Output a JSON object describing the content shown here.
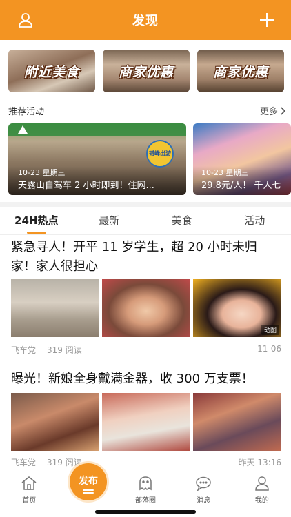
{
  "header": {
    "title": "发现",
    "left_icon": "user-icon",
    "right_icon": "plus-icon",
    "color": "#f39422"
  },
  "banners": [
    {
      "label": "附近美食"
    },
    {
      "label": "商家优惠"
    },
    {
      "label": "商家优惠"
    }
  ],
  "recommend": {
    "title": "推荐活动",
    "more_label": "更多"
  },
  "activities": [
    {
      "date": "10-23 星期三",
      "desc": "天露山自驾车 2 小时即到！住网...",
      "badge": "错峰出游"
    },
    {
      "date": "10-23 星期三",
      "desc": "29.8元/人！ 千人七"
    }
  ],
  "tabs": [
    {
      "label": "24H热点",
      "active": true
    },
    {
      "label": "最新",
      "active": false
    },
    {
      "label": "美食",
      "active": false
    },
    {
      "label": "活动",
      "active": false
    }
  ],
  "articles": [
    {
      "title": "紧急寻人！开平 11 岁学生，超 20 小时未归家！家人很担心",
      "author": "飞车党",
      "reads": "319 阅读",
      "time": "11-06",
      "image_tag": "动图"
    },
    {
      "title": "曝光！新娘全身戴满金器，收 300 万支票！",
      "author": "飞车党",
      "reads": "319 阅读",
      "time": "昨天 13:16"
    }
  ],
  "bottom_nav": {
    "items": [
      {
        "label": "首页",
        "icon": "home-icon"
      },
      {
        "label": "部落圈",
        "icon": "ghost-icon"
      },
      {
        "label": "消息",
        "icon": "message-icon"
      },
      {
        "label": "我的",
        "icon": "user-icon"
      }
    ],
    "publish_label": "发布"
  }
}
